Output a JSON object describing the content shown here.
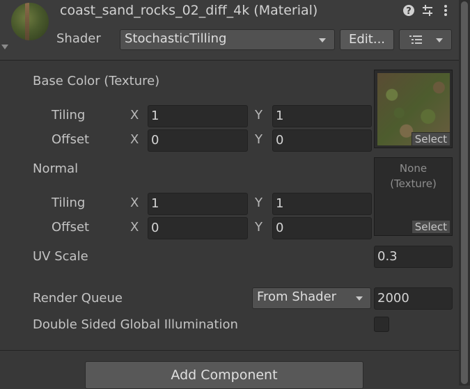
{
  "header": {
    "title": "coast_sand_rocks_02_diff_4k (Material)",
    "help_icon": "help-icon",
    "preset_icon": "sliders-icon",
    "menu_icon": "kebab-menu-icon"
  },
  "shader": {
    "label": "Shader",
    "value": "StochasticTilling",
    "edit_label": "Edit...",
    "list_icon": "list-icon"
  },
  "base_color": {
    "label": "Base Color (Texture)",
    "tiling_label": "Tiling",
    "offset_label": "Offset",
    "tiling_x": "1",
    "tiling_y": "1",
    "offset_x": "0",
    "offset_y": "0",
    "select_label": "Select"
  },
  "normal": {
    "label": "Normal",
    "tiling_label": "Tiling",
    "offset_label": "Offset",
    "tiling_x": "1",
    "tiling_y": "1",
    "offset_x": "0",
    "offset_y": "0",
    "none_line1": "None",
    "none_line2": "(Texture)",
    "select_label": "Select"
  },
  "axis": {
    "x": "X",
    "y": "Y"
  },
  "uv_scale": {
    "label": "UV Scale",
    "value": "0.3"
  },
  "render_queue": {
    "label": "Render Queue",
    "mode": "From Shader",
    "value": "2000"
  },
  "double_sided": {
    "label": "Double Sided Global Illumination",
    "checked": false
  },
  "footer": {
    "add_component": "Add Component"
  }
}
